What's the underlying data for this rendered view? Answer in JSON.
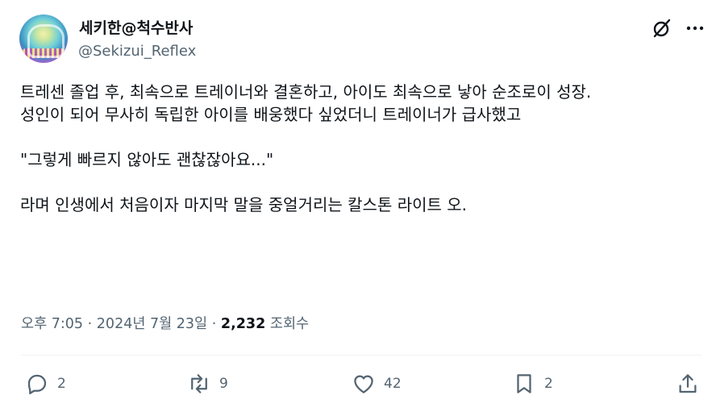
{
  "author": {
    "display_name": "세키한@척수반사",
    "handle": "@Sekizui_Reflex"
  },
  "header_icons": [
    "grok-icon",
    "more-icon"
  ],
  "tweet": {
    "text": "트레센 졸업 후, 최속으로 트레이너와 결혼하고, 아이도 최속으로 낳아 순조로이 성장.\n성인이 되어 무사히 독립한 아이를 배웅했다 싶었더니 트레이너가 급사했고\n\n\"그렇게 빠르지 않아도 괜찮잖아요...\"\n\n라며 인생에서 처음이자 마지막 말을 중얼거리는 칼스톤 라이트 오."
  },
  "meta": {
    "time": "오후 7:05",
    "separator": "·",
    "date": "2024년 7월 23일",
    "views_count": "2,232",
    "views_label": "조회수"
  },
  "actions": {
    "reply_count": "2",
    "retweet_count": "9",
    "like_count": "42",
    "bookmark_count": "2"
  },
  "colors": {
    "text_primary": "#0f1419",
    "text_secondary": "#536471",
    "divider": "#eff3f4"
  }
}
